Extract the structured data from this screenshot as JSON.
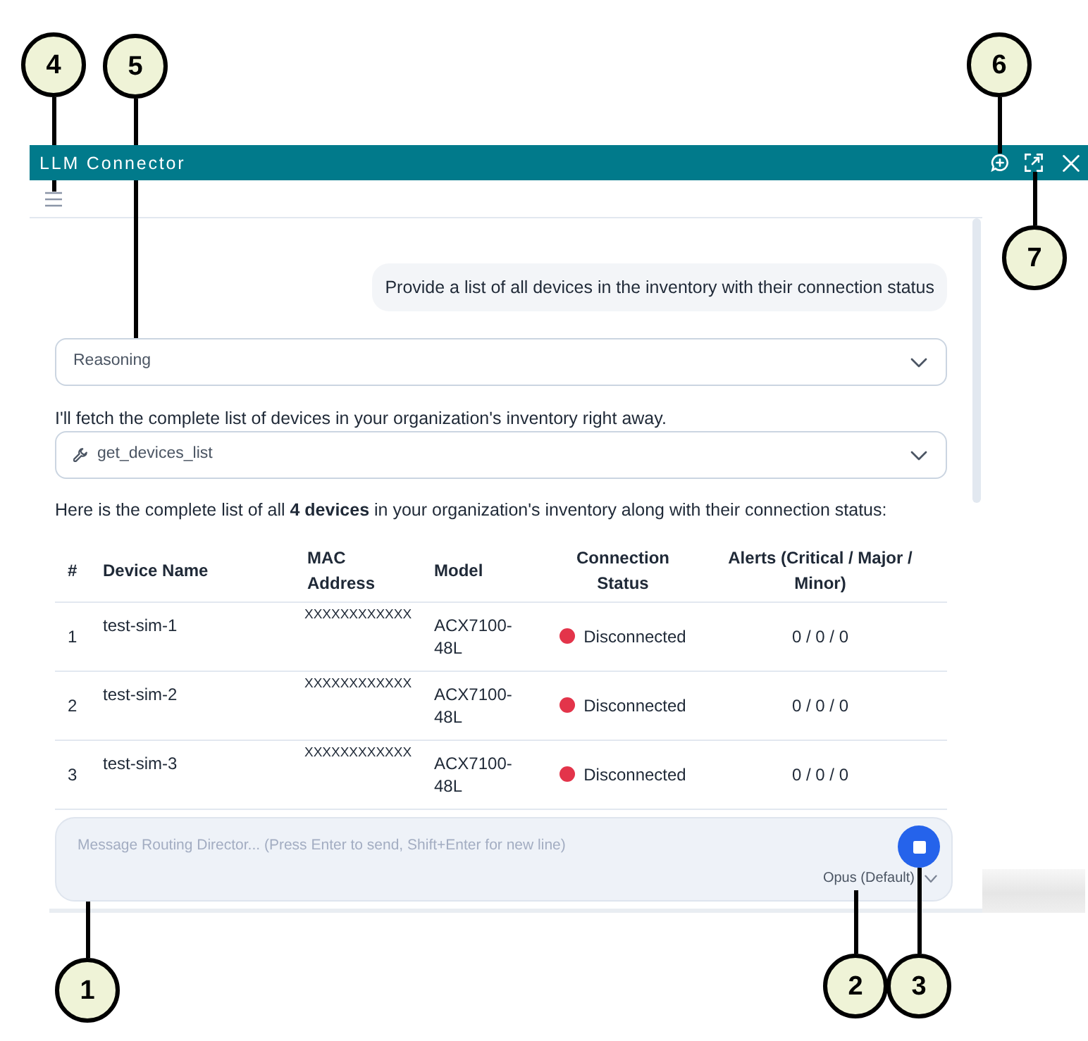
{
  "window": {
    "title": "LLM Connector"
  },
  "conversation": {
    "user_message": "Provide a list of all devices in the inventory with their connection status",
    "reasoning": {
      "label": "Reasoning",
      "expanded": false
    },
    "intro": "I'll fetch the complete list of devices in your organization's inventory right away.",
    "tool_call": {
      "label": "get_devices_list",
      "expanded": false
    },
    "summary": "Here is the complete list of all **4 devices** in your organization's inventory along with their connection status:",
    "table": {
      "columns": [
        "#",
        "Device Name",
        "MAC Address",
        "Model",
        "Connection Status",
        "Alerts (Critical / Major / Minor)"
      ],
      "rows": [
        {
          "number": "1",
          "device_name": "test-sim-1",
          "mac_address": "XXXXXXXXXXXX",
          "model": "ACX7100-48L",
          "status": "Disconnected",
          "color": "#e3344a",
          "alerts": "0 / 0 / 0"
        },
        {
          "number": "2",
          "device_name": "test-sim-2",
          "mac_address": "XXXXXXXXXXXX",
          "model": "ACX7100-48L",
          "status": "Disconnected",
          "color": "#e3344a",
          "alerts": "0 / 0 / 0"
        },
        {
          "number": "3",
          "device_name": "test-sim-3",
          "mac_address": "XXXXXXXXXXXX",
          "model": "ACX7100-48L",
          "status": "Disconnected",
          "color": "#e3344a",
          "alerts": "0 / 0 / 0"
        }
      ]
    }
  },
  "composer": {
    "placeholder": "Message Routing Director... (Press Enter to send, Shift+Enter for new line)",
    "model": "Opus (Default)"
  },
  "callouts": [
    "4",
    "5",
    "6",
    "7",
    "1",
    "2",
    "3"
  ]
}
